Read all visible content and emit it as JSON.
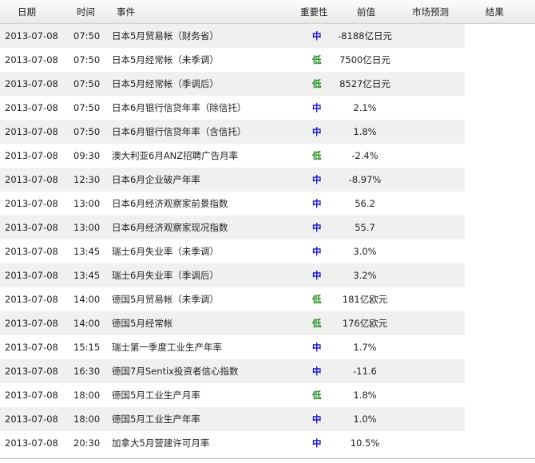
{
  "header": {
    "date": "日期",
    "time": "时间",
    "event": "事件",
    "importance": "重要性",
    "previous": "前值",
    "forecast": "市场预测",
    "result": "结果"
  },
  "rows": [
    {
      "date": "2013-07-08",
      "time": "07:50",
      "event": "日本5月贸易帐（财务省）",
      "importance": "中",
      "level": "high",
      "previous": "-8188亿日元"
    },
    {
      "date": "2013-07-08",
      "time": "07:50",
      "event": "日本5月经常帐（未季调）",
      "importance": "低",
      "level": "low",
      "previous": "7500亿日元"
    },
    {
      "date": "2013-07-08",
      "time": "07:50",
      "event": "日本5月经常帐（季调后）",
      "importance": "低",
      "level": "low",
      "previous": "8527亿日元"
    },
    {
      "date": "2013-07-08",
      "time": "07:50",
      "event": "日本6月银行信贷年率（除信托）",
      "importance": "中",
      "level": "high",
      "previous": "2.1%"
    },
    {
      "date": "2013-07-08",
      "time": "07:50",
      "event": "日本6月银行信贷年率（含信托）",
      "importance": "中",
      "level": "high",
      "previous": "1.8%"
    },
    {
      "date": "2013-07-08",
      "time": "09:30",
      "event": "澳大利亚6月ANZ招聘广告月率",
      "importance": "低",
      "level": "low",
      "previous": "-2.4%"
    },
    {
      "date": "2013-07-08",
      "time": "12:30",
      "event": "日本6月企业破产年率",
      "importance": "中",
      "level": "high",
      "previous": "-8.97%"
    },
    {
      "date": "2013-07-08",
      "time": "13:00",
      "event": "日本6月经济观察家前景指数",
      "importance": "中",
      "level": "high",
      "previous": "56.2"
    },
    {
      "date": "2013-07-08",
      "time": "13:00",
      "event": "日本6月经济观察家现况指数",
      "importance": "中",
      "level": "high",
      "previous": "55.7"
    },
    {
      "date": "2013-07-08",
      "time": "13:45",
      "event": "瑞士6月失业率（未季调）",
      "importance": "中",
      "level": "high",
      "previous": "3.0%"
    },
    {
      "date": "2013-07-08",
      "time": "13:45",
      "event": "瑞士6月失业率（季调后）",
      "importance": "中",
      "level": "high",
      "previous": "3.2%"
    },
    {
      "date": "2013-07-08",
      "time": "14:00",
      "event": "德国5月贸易帐（未季调）",
      "importance": "低",
      "level": "low",
      "previous": "181亿欧元"
    },
    {
      "date": "2013-07-08",
      "time": "14:00",
      "event": "德国5月经常帐",
      "importance": "低",
      "level": "low",
      "previous": "176亿欧元"
    },
    {
      "date": "2013-07-08",
      "time": "15:15",
      "event": "瑞士第一季度工业生产年率",
      "importance": "中",
      "level": "high",
      "previous": "1.7%"
    },
    {
      "date": "2013-07-08",
      "time": "16:30",
      "event": "德国7月Sentix投资者信心指数",
      "importance": "中",
      "level": "high",
      "previous": "-11.6"
    },
    {
      "date": "2013-07-08",
      "time": "18:00",
      "event": "德国5月工业生产月率",
      "importance": "低",
      "level": "low",
      "previous": "1.8%"
    },
    {
      "date": "2013-07-08",
      "time": "18:00",
      "event": "德国5月工业生产年率",
      "importance": "中",
      "level": "high",
      "previous": "1.0%"
    },
    {
      "date": "2013-07-08",
      "time": "20:30",
      "event": "加拿大5月营建许可月率",
      "importance": "中",
      "level": "high",
      "previous": "10.5%"
    }
  ],
  "colors": {
    "importance_high": "#1414c8",
    "importance_low": "#1f8a1f",
    "row_alt": "#f0f0f0"
  }
}
